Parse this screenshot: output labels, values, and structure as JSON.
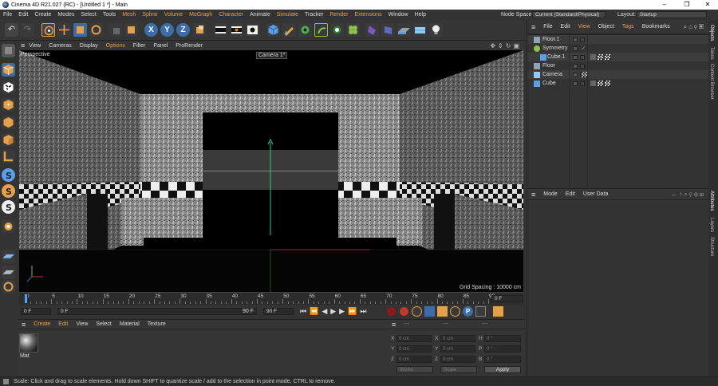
{
  "window": {
    "title": "Cinema 4D R21.027 (RC) - [Untitled 1 *] - Main",
    "controls": [
      "–",
      "❐",
      "✕"
    ]
  },
  "menubar": {
    "items": [
      "File",
      "Edit",
      "Create",
      "Modes",
      "Select",
      "Tools",
      "Mesh",
      "Spline",
      "Volume",
      "MoGraph",
      "Character",
      "Animate",
      "Simulate",
      "Tracker",
      "Render",
      "Extensions",
      "Window",
      "Help"
    ],
    "node_space_label": "Node Space:",
    "node_space_value": "Current (Standard/Physical)",
    "layout_label": "Layout:",
    "layout_value": "Startup"
  },
  "viewport": {
    "menu": [
      "View",
      "Cameras",
      "Display",
      "Options",
      "Filter",
      "Panel",
      "ProRender"
    ],
    "view_name": "Perspective",
    "camera_label": "Camera 1*",
    "grid_spacing": "Grid Spacing : 10000 cm"
  },
  "timeline": {
    "ticks": [
      "0",
      "5",
      "10",
      "15",
      "20",
      "25",
      "30",
      "35",
      "40",
      "45",
      "50",
      "55",
      "60",
      "65",
      "70",
      "75",
      "80",
      "85",
      "90"
    ],
    "current_frame": "0 F"
  },
  "transport": {
    "start": "0 F",
    "current": "0 F",
    "end": "90 F",
    "max": "90 F"
  },
  "material_panel": {
    "menu": [
      "Create",
      "Edit",
      "View",
      "Select",
      "Material",
      "Texture"
    ],
    "materials": [
      {
        "name": "Mat"
      }
    ]
  },
  "coord_panel": {
    "header": [
      "---",
      "---",
      "---"
    ],
    "rows": [
      {
        "a": "X",
        "av": "0 cm",
        "b": "X",
        "bv": "0 cm",
        "c": "H",
        "cv": "0 °"
      },
      {
        "a": "Y",
        "av": "0 cm",
        "b": "Y",
        "bv": "0 cm",
        "c": "P",
        "cv": "0 °"
      },
      {
        "a": "Z",
        "av": "0 cm",
        "b": "Z",
        "bv": "0 cm",
        "c": "B",
        "cv": "0 °"
      }
    ],
    "mode": "World",
    "scale": "Scale",
    "apply": "Apply"
  },
  "object_panel": {
    "menu": [
      "File",
      "Edit",
      "View",
      "Object",
      "Tags",
      "Bookmarks"
    ],
    "objects": [
      {
        "name": "Floor.1",
        "indent": 0
      },
      {
        "name": "Symmetry",
        "indent": 0
      },
      {
        "name": "Cube.1",
        "indent": 1
      },
      {
        "name": "Floor",
        "indent": 0
      },
      {
        "name": "Camera",
        "indent": 0
      },
      {
        "name": "Cube",
        "indent": 0
      }
    ]
  },
  "attr_panel": {
    "menu": [
      "Mode",
      "Edit",
      "User Data"
    ]
  },
  "side_tabs": [
    "Objects",
    "Takes",
    "Content Browser",
    "Attributes",
    "Layers",
    "Structure"
  ],
  "status": "Scale: Click and drag to scale elements. Hold down SHIFT to quantize scale / add to the selection in point mode, CTRL to remove.",
  "colors": {
    "accent": "#e6a04a",
    "toolbar_blue": "#3b6ea8",
    "highlight_orange": "#d97a1a"
  }
}
